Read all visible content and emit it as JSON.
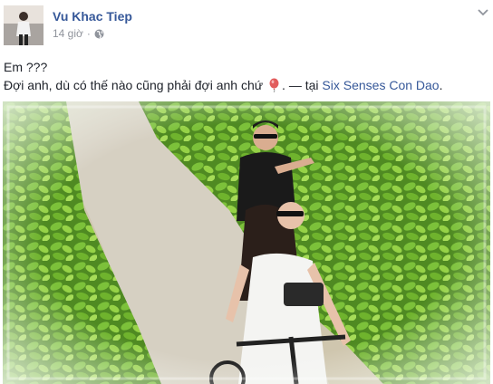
{
  "post": {
    "author": "Vu Khac Tiep",
    "time": "14 giờ",
    "privacy_icon": "globe-icon",
    "line1": "Em ???",
    "line2_text": "Đợi anh, dù có thế nào cũng phải đợi anh chứ",
    "line2_emoji": "balloon-icon",
    "line2_sep": ". — tại",
    "location": "Six Senses Con Dao",
    "line2_end": "."
  },
  "colors": {
    "link": "#365899",
    "text": "#1d2129",
    "meta": "#90949c"
  }
}
